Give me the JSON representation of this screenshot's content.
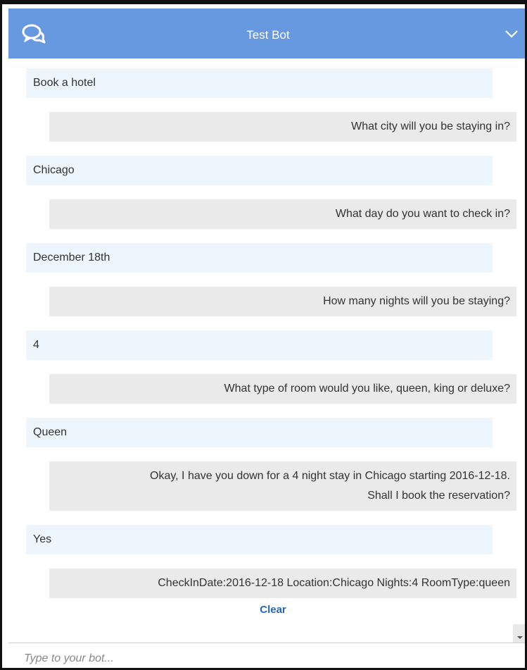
{
  "header": {
    "icon": "chat-bubbles-icon",
    "title": "Test Bot",
    "collapse_icon": "chevron-down-icon"
  },
  "messages": [
    {
      "from": "user",
      "text": "Book a hotel"
    },
    {
      "from": "bot",
      "text": "What city will you be staying in?"
    },
    {
      "from": "user",
      "text": "Chicago"
    },
    {
      "from": "bot",
      "text": "What day do you want to check in?"
    },
    {
      "from": "user",
      "text": "December 18th"
    },
    {
      "from": "bot",
      "text": "How many nights will you be staying?"
    },
    {
      "from": "user",
      "text": "4"
    },
    {
      "from": "bot",
      "text": "What type of room would you like, queen, king or deluxe?"
    },
    {
      "from": "user",
      "text": "Queen"
    },
    {
      "from": "bot",
      "lines": [
        "Okay, I have you down for a 4 night stay in Chicago starting 2016-12-18.",
        "Shall I book the reservation?"
      ]
    },
    {
      "from": "user",
      "text": "Yes"
    },
    {
      "from": "bot",
      "text": "CheckInDate:2016-12-18 Location:Chicago Nights:4 RoomType:queen"
    }
  ],
  "clear_label": "Clear",
  "input": {
    "value": "",
    "placeholder": "Type to your bot..."
  },
  "colors": {
    "header_bg": "#6699e0",
    "user_bubble": "#eef6fd",
    "bot_bubble": "#eaeaea",
    "link": "#2266bb"
  }
}
